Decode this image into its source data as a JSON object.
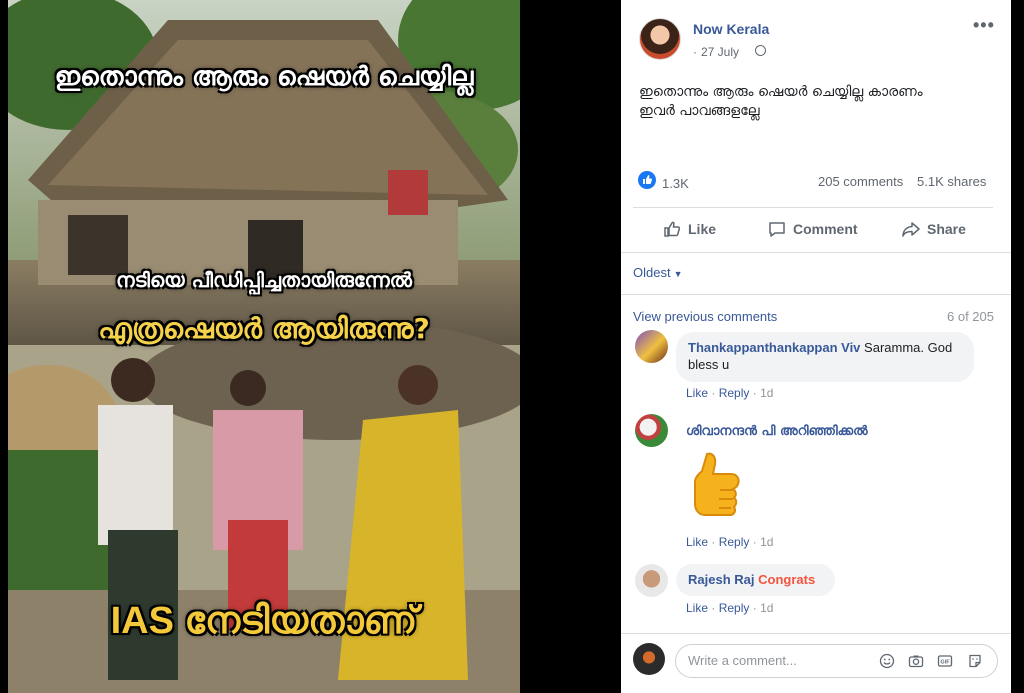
{
  "meme": {
    "line1": "ഇതൊന്നും ആരും ഷെയർ ചെയ്യില്ല",
    "line2": "നടിയെ പീഡിപ്പിച്ചതായിരുന്നേൽ",
    "line3": "എത്രഷെയർ ആയിരുന്നു?",
    "line4": "IAS നേടിയതാണ്"
  },
  "post": {
    "page_name": "Now Kerala",
    "date": "27 July",
    "text_line1": "ഇതൊന്നും ആരും ഷെയർ ചെയ്യില്ല കാരണം",
    "text_line2": "ഇവർ പാവങ്ങളല്ലേ",
    "like_count": "1.3K",
    "comments_count": "205 comments",
    "shares_count": "5.1K shares"
  },
  "actions": {
    "like": "Like",
    "comment": "Comment",
    "share": "Share"
  },
  "comments_section": {
    "sort_label": "Oldest",
    "view_previous": "View previous comments",
    "count_of": "6 of 205",
    "items": [
      {
        "author": "Thankappanthankappan Viv",
        "text": "Saramma. God bless u",
        "like": "Like",
        "reply": "Reply",
        "time": "1d"
      },
      {
        "author": "ശിവാനന്ദൻ പി അറിഞ്ഞിക്കൽ",
        "text": "",
        "sticker": "thumbs-up-sticker",
        "like": "Like",
        "reply": "Reply",
        "time": "1d"
      },
      {
        "author": "Rajesh Raj",
        "text": "Congrats",
        "like": "Like",
        "reply": "Reply",
        "time": "1d"
      }
    ],
    "write_placeholder": "Write a comment..."
  },
  "icons": {
    "more": "more-options-icon",
    "privacy": "globe-icon",
    "reaction": "like-reaction-icon",
    "emoji": "emoji-icon",
    "camera": "camera-icon",
    "gif": "gif-icon",
    "sticker": "sticker-icon"
  },
  "colors": {
    "brand_blue": "#385898",
    "like_blue": "#1877f2",
    "congrats_orange": "#f5533d"
  }
}
